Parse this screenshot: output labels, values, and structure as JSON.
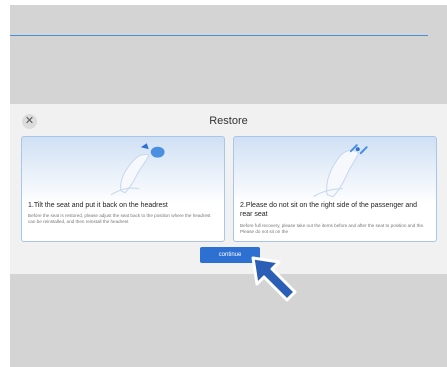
{
  "dialog": {
    "title": "Restore",
    "close_icon": "close-icon",
    "continue_label": "continue"
  },
  "cards": [
    {
      "title": "1.Tilt the seat and put it back on the headrest",
      "description": "Before the seat is restored, please adjust the seat back to the position where the headrest can be reinstalled, and then reinstall the headrest"
    },
    {
      "title": "2.Please do not sit on the right side of the passenger and rear seat",
      "description": "Before full recovery, please take out the items before and after the seat to position and the. Please do not sit on the"
    }
  ],
  "colors": {
    "accent": "#2e6fd2",
    "card_border": "#a9c6ea",
    "arrow": "#2b5fb5"
  },
  "icons": {
    "pointer": "pointer-arrow-icon",
    "seat": "seat-illustration"
  }
}
